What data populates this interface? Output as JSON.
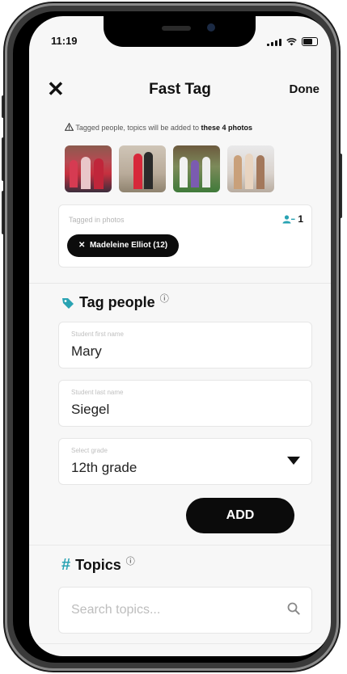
{
  "status_bar": {
    "time": "11:19"
  },
  "nav": {
    "close_icon": "close-icon",
    "title": "Fast Tag",
    "done_label": "Done"
  },
  "notice": {
    "icon": "warning-icon",
    "text": "Tagged people, topics will be added to ",
    "bold": "these 4 photos"
  },
  "photos": [
    "photo-1",
    "photo-2",
    "photo-3",
    "photo-4"
  ],
  "tagged": {
    "label": "Tagged in photos",
    "count": "1",
    "count_icon": "person-icon",
    "chips": [
      {
        "remove": "✕",
        "text": "Madeleine Elliot (12)"
      }
    ]
  },
  "tag_people": {
    "icon": "tag-icon",
    "title": "Tag people",
    "info": "ⓘ",
    "first_name": {
      "label": "Student first name",
      "value": "Mary"
    },
    "last_name": {
      "label": "Student last name",
      "value": "Siegel"
    },
    "grade": {
      "label": "Select grade",
      "value": "12th grade"
    },
    "add_label": "ADD"
  },
  "topics": {
    "icon": "#",
    "title": "Topics",
    "info": "ⓘ",
    "search_placeholder": "Search topics..."
  },
  "colors": {
    "accent": "#29a3b3",
    "button": "#0b0b0b",
    "background": "#f7f7f7"
  }
}
